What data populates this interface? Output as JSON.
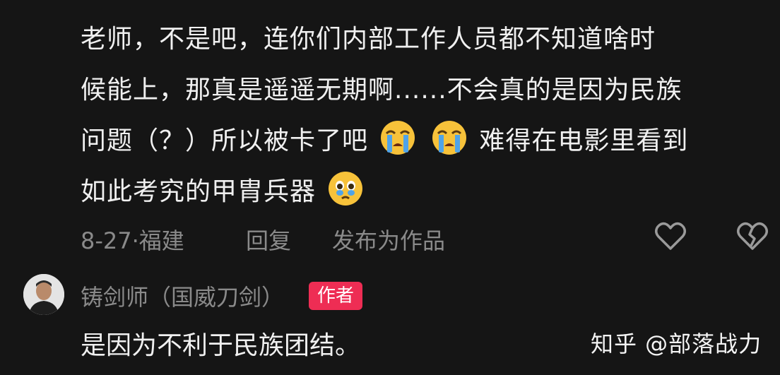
{
  "comment": {
    "line1": "老师，不是吧，连你们内部工作人员都不知道啥时",
    "line2": "候能上，那真是遥遥无期啊......不会真的是因为民族",
    "line3_before_emoji": "问题（？）所以被卡了吧",
    "line3_after_emoji": "难得在电影里看到",
    "line4_before_emoji": "如此考究的甲胄兵器",
    "emojis": [
      "crying-face-emoji",
      "crying-face-emoji",
      "teary-face-emoji"
    ]
  },
  "meta": {
    "date_location": "8-27·福建",
    "reply_label": "回复",
    "publish_label": "发布为作品",
    "like_icon": "heart-outline-icon",
    "dislike_icon": "broken-heart-icon"
  },
  "reply": {
    "author_name": "铸剑师（国威刀剑）",
    "author_badge": "作者",
    "badge_color": "#ee2d54",
    "text": "是因为不利于民族团结。"
  },
  "watermark": {
    "text": "知乎 @部落战力"
  }
}
